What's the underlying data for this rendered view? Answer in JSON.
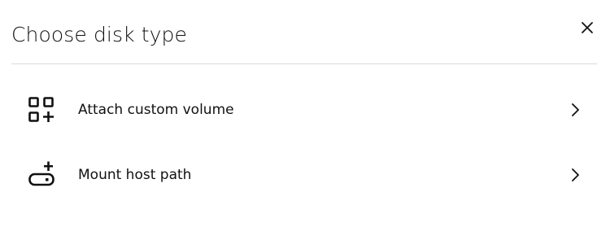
{
  "dialog": {
    "title": "Choose disk type",
    "close_icon": "close-icon"
  },
  "options": [
    {
      "label": "Attach custom volume",
      "icon": "apps-add-icon",
      "chevron": "chevron-right-icon"
    },
    {
      "label": "Mount host path",
      "icon": "drive-add-icon",
      "chevron": "chevron-right-icon"
    }
  ],
  "colors": {
    "text": "#111111",
    "divider": "#d9d9d9",
    "background": "#ffffff"
  }
}
